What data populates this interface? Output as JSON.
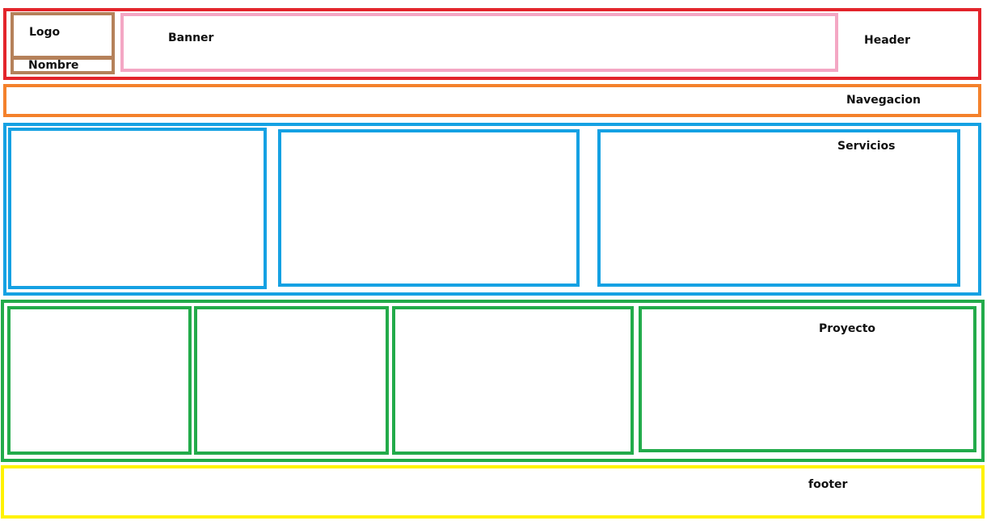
{
  "header": {
    "label": "Header",
    "logo_label": "Logo",
    "nombre_label": "Nombre",
    "banner_label": "Banner"
  },
  "navigation": {
    "label": "Navegacion"
  },
  "services": {
    "label": "Servicios"
  },
  "projects": {
    "label": "Proyecto"
  },
  "footer": {
    "label": "footer"
  },
  "colors": {
    "header": "#e3242b",
    "logo": "#b5815a",
    "banner": "#f4a7c4",
    "navigation": "#f4812b",
    "services": "#15a1e3",
    "projects": "#22ab4a",
    "footer": "#fff200"
  }
}
